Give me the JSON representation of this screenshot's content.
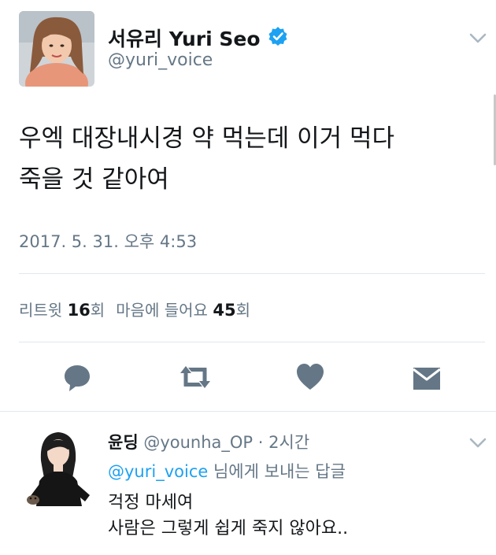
{
  "tweet": {
    "author": {
      "display_name": "서유리 Yuri Seo",
      "handle": "@yuri_voice",
      "verified_icon": "verified-badge-icon"
    },
    "text_line1": "우엑 대장내시경 약 먹는데 이거 먹다",
    "text_line2": "죽을 것 같아여",
    "timestamp": "2017. 5. 31. 오후 4:53",
    "stats": {
      "retweets_label": "리트윗",
      "retweets_count": "16",
      "retweets_unit": "회",
      "likes_label": "마음에 들어요",
      "likes_count": "45",
      "likes_unit": "회"
    },
    "actions": [
      "reply-icon",
      "retweet-icon",
      "like-icon",
      "message-icon"
    ]
  },
  "reply": {
    "display_name": "윤딩",
    "handle": "@younha_OP",
    "separator": "·",
    "time": "2시간",
    "reply_to_mention": "@yuri_voice",
    "reply_to_suffix": "님에게 보내는 답글",
    "text_line1": "걱정 마세여",
    "text_line2": "사람은 그렇게 쉽게 죽지 않아요.."
  },
  "colors": {
    "text": "#14171a",
    "secondary": "#657786",
    "accent": "#1da1f2",
    "divider": "#e1e8ed",
    "icon": "#657786"
  }
}
